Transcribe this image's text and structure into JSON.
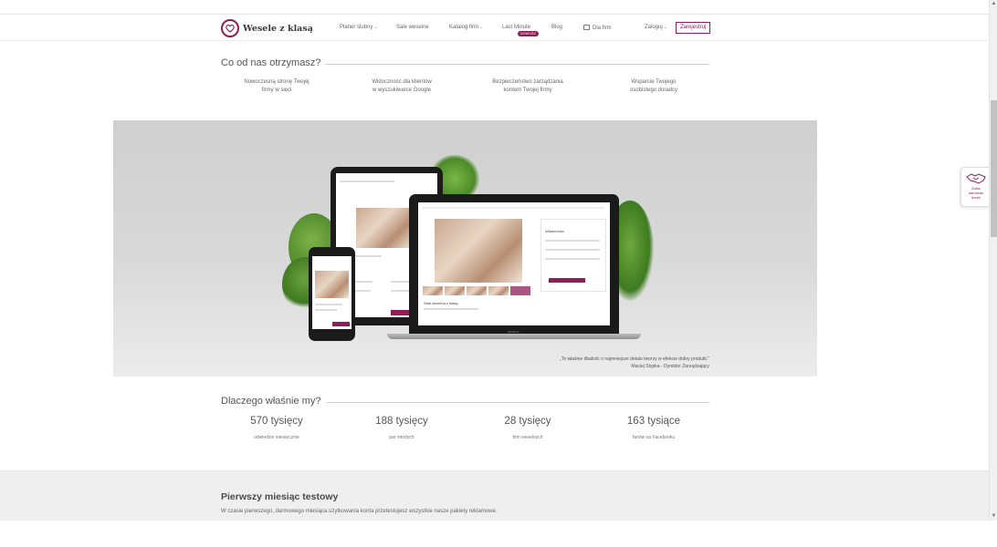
{
  "header": {
    "logo_text": "Wesele z klasą",
    "nav": {
      "planer": "Planer ślubny",
      "sale": "Sale weselne",
      "katalog": "Katalog firm",
      "last_minute": "Last Minute",
      "badge": "NOWOŚĆ",
      "blog": "Blog",
      "dla_firm": "Dla firm",
      "login": "Zaloguj",
      "register": "Zarejestruj"
    }
  },
  "what_you_get": {
    "title": "Co od nas otrzymasz?",
    "items": [
      {
        "line1": "Nowoczesną stronę Twojej",
        "line2": "firmy w sieci"
      },
      {
        "line1": "Widoczność dla klientów",
        "line2": "w wyszukiwarce Google"
      },
      {
        "line1": "Bezpieczeństwo zarządzania",
        "line2": "kontem Twojej firmy"
      },
      {
        "line1": "Wsparcie Twojego",
        "line2": "osobistego doradcy"
      }
    ]
  },
  "banner": {
    "quote": "„To właśnie dbałość o najmniejsze detale tworzy w efekcie dobry produkt.\"",
    "author": "Maciej Stypka - Dyrektor Zarządzający",
    "mock_title": "Sala weselna z klasą",
    "mock_heading": "Wiadomość",
    "laptop_brand": "MacBook"
  },
  "why_us": {
    "title": "Dlaczego właśnie my?",
    "stats": [
      {
        "value": "570 tysięcy",
        "label": "odwiedzin miesięcznie"
      },
      {
        "value": "188 tysięcy",
        "label": "par młodych"
      },
      {
        "value": "28 tysięcy",
        "label": "firm weselnych"
      },
      {
        "value": "163 tysiące",
        "label": "fanów na Facebooku"
      }
    ]
  },
  "trial": {
    "title": "Pierwszy miesiąc testowy",
    "text": "W czasie pierwszego, darmowego miesiąca użytkowania konta przetestujesz wszystkie nasze pakiety reklamowe."
  },
  "widget": {
    "line1": "Załóż",
    "line2": "darmowe",
    "line3": "konto"
  },
  "colors": {
    "brand": "#8e1d5a",
    "text": "#555555",
    "grey_section": "#efefef"
  }
}
